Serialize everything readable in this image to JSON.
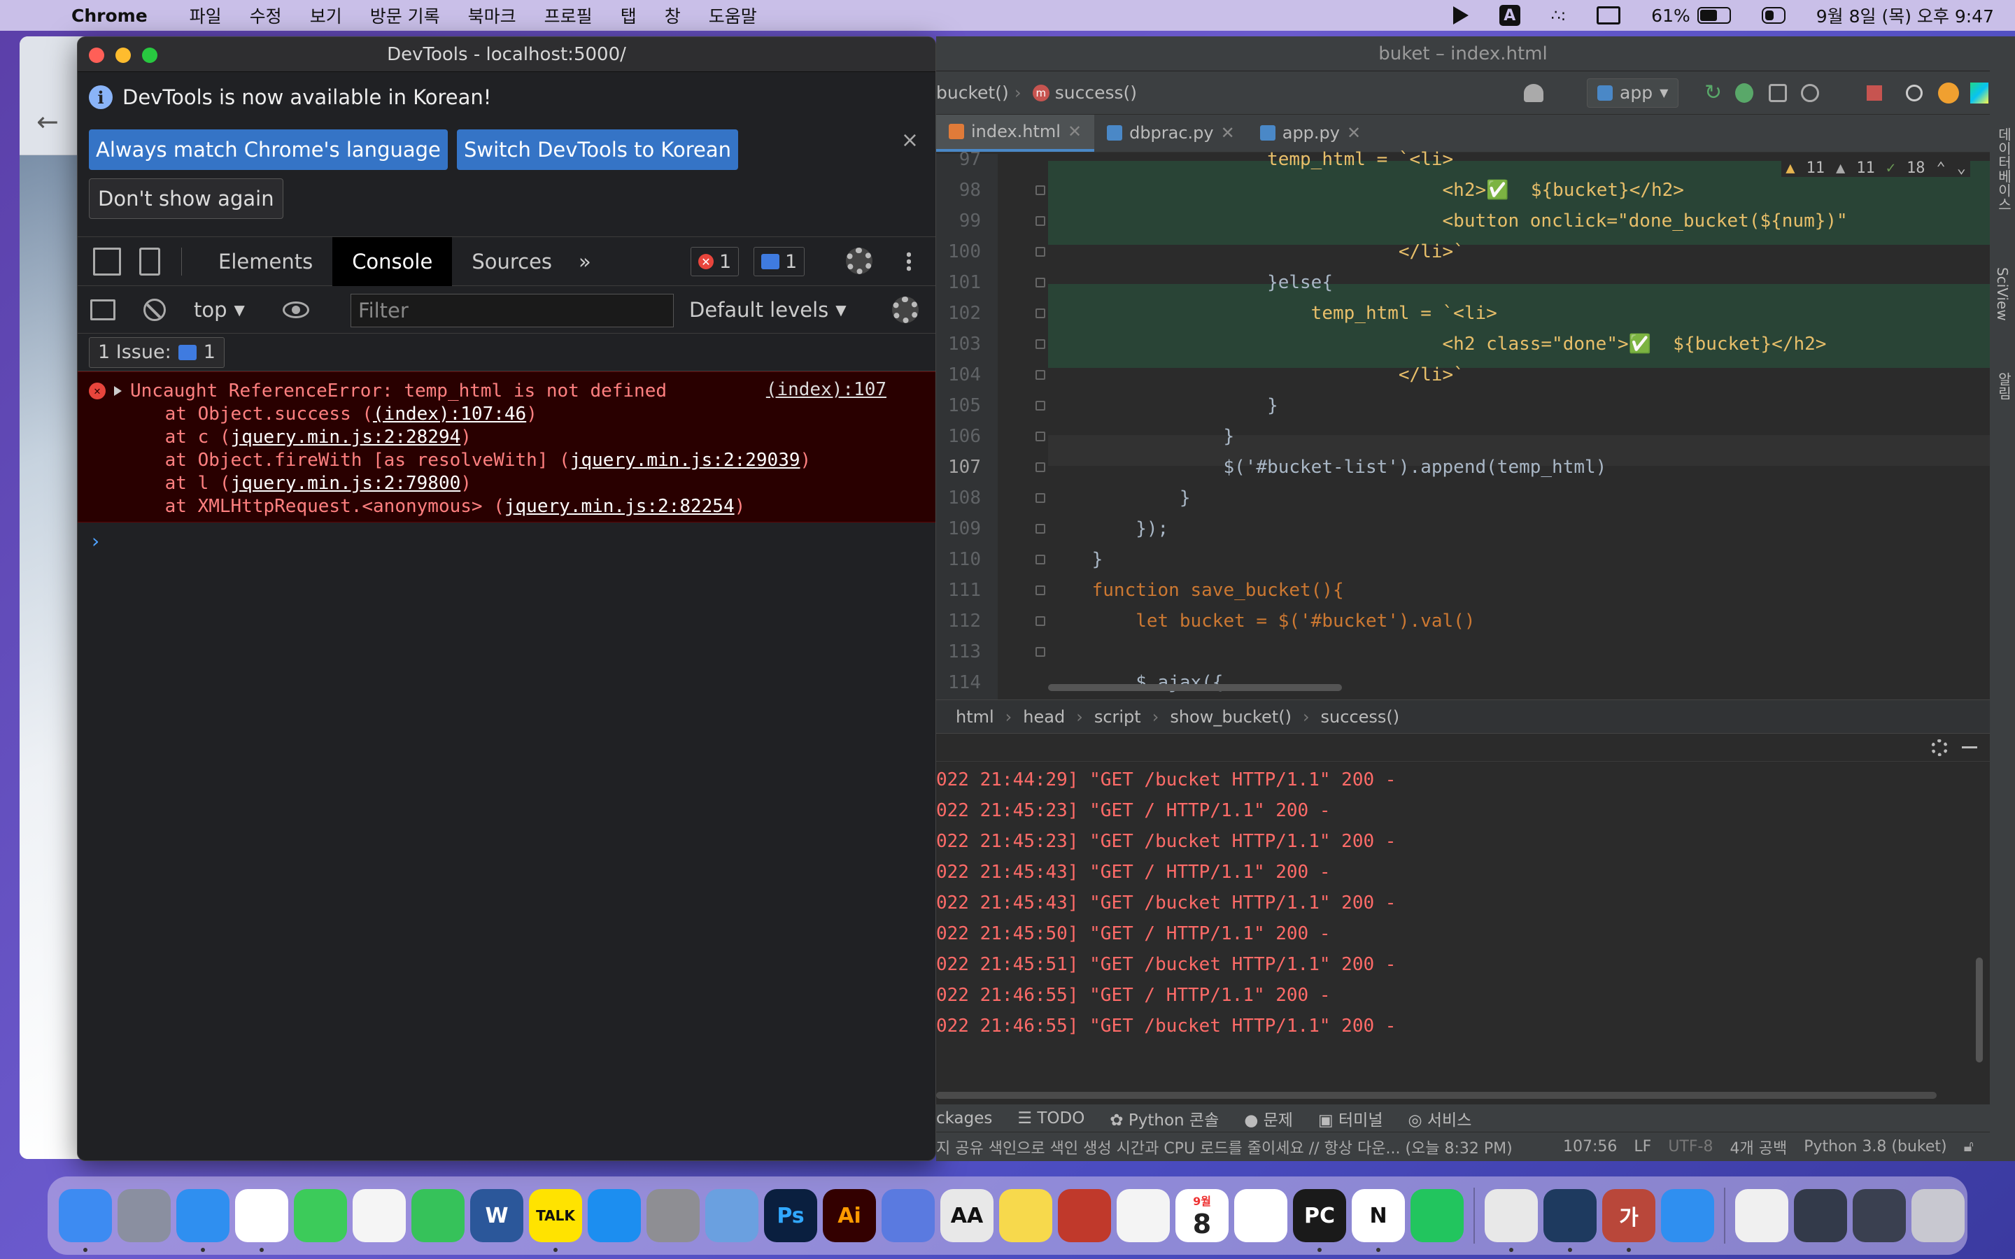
{
  "menubar": {
    "app": "Chrome",
    "items": [
      "파일",
      "수정",
      "보기",
      "방문 기록",
      "북마크",
      "프로필",
      "탭",
      "창",
      "도움말"
    ],
    "input_indicator": "A",
    "battery": "61%",
    "battery_level": 0.61,
    "datetime": "9월 8일 (목) 오후 9:47"
  },
  "devtools": {
    "title": "DevTools - localhost:5000/",
    "info_message": "DevTools is now available in Korean!",
    "btn_match": "Always match Chrome's language",
    "btn_switch": "Switch DevTools to Korean",
    "btn_dont_show": "Don't show again",
    "close": "×",
    "tabs": {
      "elements": "Elements",
      "console": "Console",
      "sources": "Sources",
      "more": "»"
    },
    "error_count": "1",
    "message_count": "1",
    "context": "top",
    "filter_placeholder": "Filter",
    "levels": "Default levels",
    "issues_label": "1 Issue:",
    "issues_count": "1",
    "error": {
      "message": "Uncaught ReferenceError: temp_html is not defined",
      "source": "(index):107",
      "stack": [
        {
          "pre": "    at Object.success (",
          "link": "(index):107:46",
          "post": ")"
        },
        {
          "pre": "    at c (",
          "link": "jquery.min.js:2:28294",
          "post": ")"
        },
        {
          "pre": "    at Object.fireWith [as resolveWith] (",
          "link": "jquery.min.js:2:29039",
          "post": ")"
        },
        {
          "pre": "    at l (",
          "link": "jquery.min.js:2:79800",
          "post": ")"
        },
        {
          "pre": "    at XMLHttpRequest.<anonymous> (",
          "link": "jquery.min.js:2:82254",
          "post": ")"
        }
      ]
    },
    "prompt": "›"
  },
  "ide": {
    "title": "buket – index.html",
    "nav_left": "bucket()",
    "nav_method": "success()",
    "run_config": "app",
    "tabs": [
      "index.html",
      "dbprac.py",
      "app.py"
    ],
    "inspections": {
      "warn1": "11",
      "warn2": "11",
      "ok": "18"
    },
    "lines": [
      {
        "n": "97",
        "t": "                    temp_html = `<li>"
      },
      {
        "n": "98",
        "t": "                                    <h2>✅  ${bucket}</h2>"
      },
      {
        "n": "99",
        "t": "                                    <button onclick=\"done_bucket(${num})\" "
      },
      {
        "n": "100",
        "t": "                                </li>`"
      },
      {
        "n": "101",
        "t": "                    }else{"
      },
      {
        "n": "102",
        "t": "                        temp_html = `<li>"
      },
      {
        "n": "103",
        "t": "                                    <h2 class=\"done\">✅  ${bucket}</h2>"
      },
      {
        "n": "104",
        "t": "                                </li>`"
      },
      {
        "n": "105",
        "t": "                    }"
      },
      {
        "n": "106",
        "t": "                }"
      },
      {
        "n": "107",
        "t": "                $('#bucket-list').append(temp_html)"
      },
      {
        "n": "108",
        "t": "            }"
      },
      {
        "n": "109",
        "t": "        });"
      },
      {
        "n": "110",
        "t": "    }"
      },
      {
        "n": "111",
        "t": "    function save_bucket(){"
      },
      {
        "n": "112",
        "t": "        let bucket = $('#bucket').val()"
      },
      {
        "n": "113",
        "t": ""
      },
      {
        "n": "114",
        "t": "        $.ajax({"
      }
    ],
    "breadcrumb": [
      "html",
      "head",
      "script",
      "show_bucket()",
      "success()"
    ],
    "log": [
      "022 21:44:29] \"GET /bucket HTTP/1.1\" 200 -",
      "022 21:45:23] \"GET / HTTP/1.1\" 200 -",
      "022 21:45:23] \"GET /bucket HTTP/1.1\" 200 -",
      "022 21:45:43] \"GET / HTTP/1.1\" 200 -",
      "022 21:45:43] \"GET /bucket HTTP/1.1\" 200 -",
      "022 21:45:50] \"GET / HTTP/1.1\" 200 -",
      "022 21:45:51] \"GET /bucket HTTP/1.1\" 200 -",
      "022 21:46:55] \"GET / HTTP/1.1\" 200 -",
      "022 21:46:55] \"GET /bucket HTTP/1.1\" 200 -"
    ],
    "bottom_tabs": [
      "ckages",
      "TODO",
      "Python 콘솔",
      "문제",
      "터미널",
      "서비스"
    ],
    "status_msg": "지 공유 색인으로 색인 생성 시간과 CPU 로드를 줄이세요 // 항상 다운... (오늘 8:32 PM)",
    "status_pos": "107:56",
    "status_lf": "LF",
    "status_enc": "UTF-8",
    "status_indent": "4개 공백",
    "status_interp": "Python 3.8 (buket)",
    "side_labels": [
      "데이터베이스",
      "SciView",
      "알림"
    ]
  },
  "dock": {
    "calendar_month": "9월",
    "calendar_day": "8",
    "items": [
      "finder",
      "launchpad",
      "safari",
      "chrome",
      "messages",
      "photos",
      "facetime",
      "word",
      "kakaotalk",
      "appstore",
      "settings",
      "preview",
      "photoshop",
      "illustrator",
      "imageviewer",
      "fontbook",
      "stickies",
      "photobooth",
      "notes",
      "calendar",
      "slack",
      "pycharm",
      "notion",
      "wakatime",
      "python",
      "quicktime",
      "gureum",
      "safari2",
      "doc",
      "screenshot1",
      "screenshot2",
      "trash"
    ],
    "labels": {
      "word": "W",
      "kakaotalk": "TALK",
      "photoshop": "Ps",
      "illustrator": "Ai",
      "fontbook": "AA",
      "pycharm": "PC",
      "notion": "N",
      "gureum": "가"
    }
  }
}
